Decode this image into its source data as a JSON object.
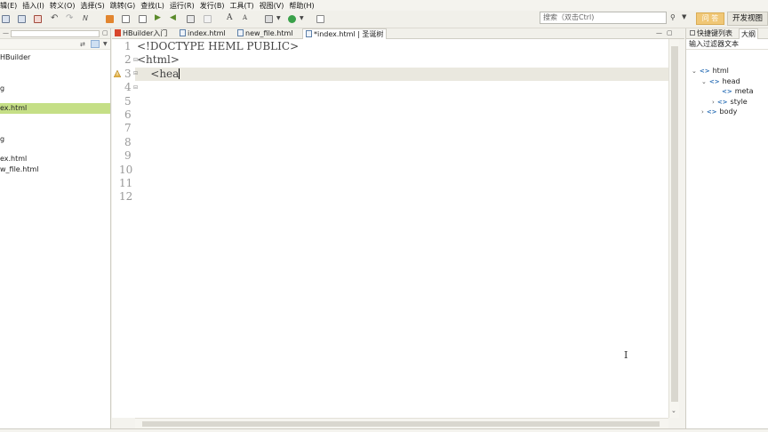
{
  "menu": [
    "辑(E)",
    "插入(I)",
    "转义(O)",
    "选择(S)",
    "跳转(G)",
    "查找(L)",
    "运行(R)",
    "发行(B)",
    "工具(T)",
    "视图(V)",
    "帮助(H)"
  ],
  "search": {
    "placeholder": "搜索（双击Ctrl)"
  },
  "top_buttons": {
    "tag_button": "问 答",
    "dev_view": "开发视图"
  },
  "left_tree": {
    "items": [
      {
        "label": "HBuilder",
        "selected": false
      },
      {
        "label": "",
        "selected": false
      },
      {
        "label": "g",
        "selected": false
      },
      {
        "label": "ex.html",
        "selected": true
      },
      {
        "label": "g",
        "selected": false
      },
      {
        "label": "ex.html",
        "selected": false
      },
      {
        "label": "w_file.html",
        "selected": false
      }
    ]
  },
  "editor_tabs": [
    {
      "label": "HBuilder入门",
      "active": false,
      "icon_color": "#d8452c"
    },
    {
      "label": "index.html",
      "active": false,
      "icon_color": "#5c7fa8"
    },
    {
      "label": "new_file.html",
      "active": false,
      "icon_color": "#5c7fa8"
    },
    {
      "label": "*index.html | 圣诞树",
      "active": true,
      "icon_color": "#5c7fa8"
    }
  ],
  "code": {
    "lines": [
      {
        "no": "1",
        "text": "<!DOCTYPE HEML PUBLIC>"
      },
      {
        "no": "2",
        "text": "<html>"
      },
      {
        "no": "3",
        "text": "    <hea"
      },
      {
        "no": "4",
        "text": ""
      },
      {
        "no": "5",
        "text": ""
      },
      {
        "no": "6",
        "text": ""
      },
      {
        "no": "7",
        "text": ""
      },
      {
        "no": "8",
        "text": ""
      },
      {
        "no": "9",
        "text": ""
      },
      {
        "no": "10",
        "text": ""
      },
      {
        "no": "11",
        "text": ""
      },
      {
        "no": "12",
        "text": ""
      }
    ]
  },
  "right_panel": {
    "tabs": [
      "快捷键列表",
      "大纲"
    ],
    "filter_placeholder": "输入过滤器文本",
    "outline": [
      {
        "label": "html",
        "depth": 0,
        "expanded": true
      },
      {
        "label": "head",
        "depth": 1,
        "expanded": true
      },
      {
        "label": "meta",
        "depth": 2,
        "expanded": false
      },
      {
        "label": "style",
        "depth": 2,
        "expanded": false,
        "collapsible": true
      },
      {
        "label": "body",
        "depth": 1,
        "expanded": false,
        "collapsible": true
      }
    ]
  },
  "colors": {
    "selected_row": "#c5df86",
    "current_line": "#eae8df",
    "accent_orange": "#f0c776"
  }
}
